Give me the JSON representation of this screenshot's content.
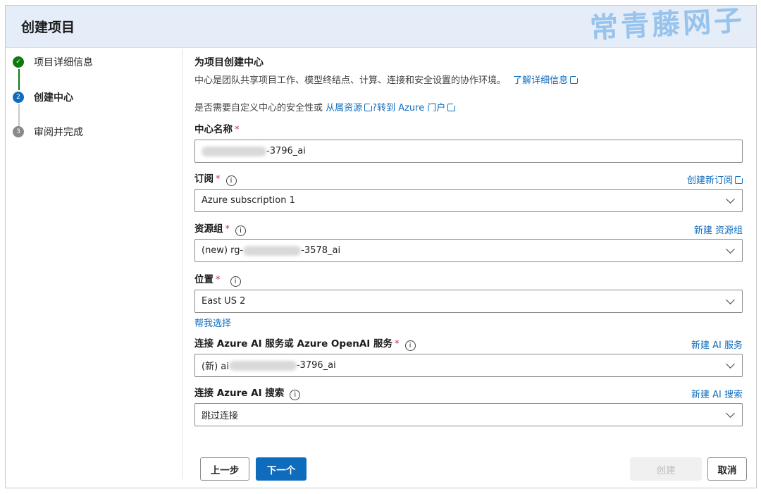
{
  "header": {
    "title": "创建项目",
    "watermark": "常青藤网子"
  },
  "steps": [
    {
      "label": "项目详细信息",
      "state": "done",
      "marker": "✓"
    },
    {
      "label": "创建中心",
      "state": "active",
      "marker": "2"
    },
    {
      "label": "审阅并完成",
      "state": "pending",
      "marker": "3"
    }
  ],
  "section": {
    "title": "为项目创建中心",
    "description": "中心是团队共享项目工作、模型终结点、计算、连接和安全设置的协作环境。",
    "learn_more": "了解详细信息",
    "question_prefix": "是否需要自定义中心的安全性或",
    "link_resource": "从属资源",
    "link_portal": "?转到 Azure 门户"
  },
  "fields": {
    "hub_name": {
      "label": "中心名称",
      "value_suffix": "-3796_ai"
    },
    "subscription": {
      "label": "订阅",
      "value": "Azure subscription 1",
      "side_link": "创建新订阅"
    },
    "resource_group": {
      "label": "资源组",
      "value_prefix": "(new) rg-",
      "value_suffix": "-3578_ai",
      "side_link": "新建 资源组"
    },
    "location": {
      "label": "位置",
      "value": "East US 2",
      "help_link": "帮我选择"
    },
    "ai_service": {
      "label": "连接 Azure AI 服务或 Azure OpenAI 服务",
      "value_prefix": "(新) ai",
      "value_suffix": "-3796_ai",
      "side_link": "新建 AI 服务"
    },
    "ai_search": {
      "label": "连接 Azure AI 搜索",
      "value": "跳过连接",
      "side_link": "新建 AI 搜索"
    }
  },
  "required_mark": "*",
  "info_glyph": "i",
  "buttons": {
    "prev": "上一步",
    "next": "下一个",
    "create": "创建",
    "cancel": "取消"
  }
}
